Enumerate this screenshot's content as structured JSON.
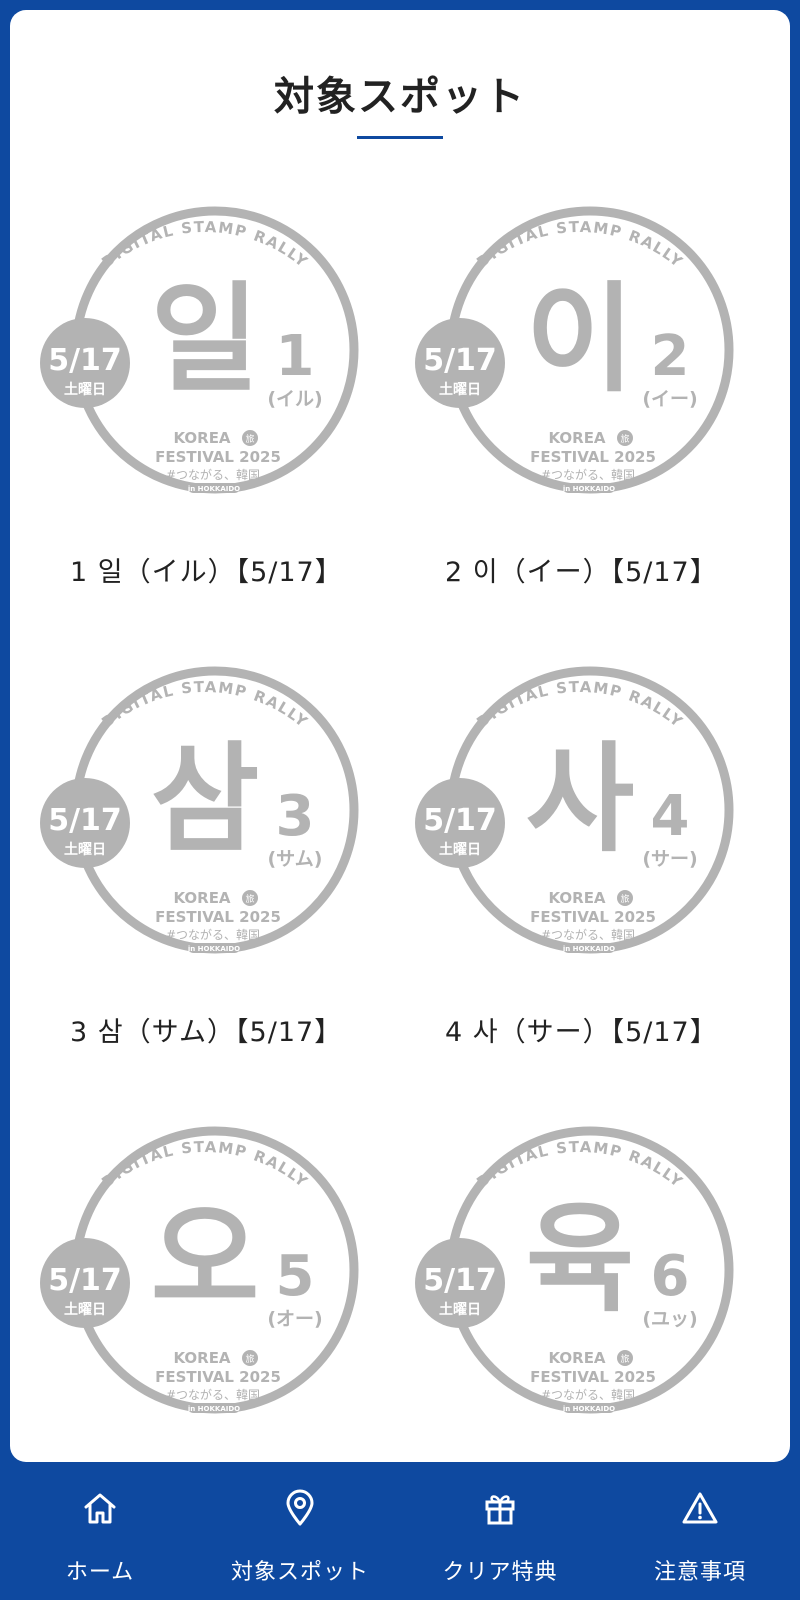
{
  "page": {
    "title": "対象スポット"
  },
  "stamp_common": {
    "arc_text": "DIGITAL STAMP RALLY",
    "date": "5/17",
    "weekday": "土曜日",
    "logo_line1": "KOREA",
    "logo_badge": "旅",
    "logo_line2": "FESTIVAL 2025",
    "hashtag": "#つながる、韓国",
    "location": "in HOKKAIDO"
  },
  "spots": [
    {
      "hangul": "일",
      "number": "1",
      "reading": "(イル)",
      "label": "1 일（イル）【5/17】"
    },
    {
      "hangul": "이",
      "number": "2",
      "reading": "(イー)",
      "label": "2 이（イー）【5/17】"
    },
    {
      "hangul": "삼",
      "number": "3",
      "reading": "(サム)",
      "label": "3 삼（サム）【5/17】"
    },
    {
      "hangul": "사",
      "number": "4",
      "reading": "(サー)",
      "label": "4 사（サー）【5/17】"
    },
    {
      "hangul": "오",
      "number": "5",
      "reading": "(オー)",
      "label": ""
    },
    {
      "hangul": "육",
      "number": "6",
      "reading": "(ユッ)",
      "label": ""
    }
  ],
  "colors": {
    "brand_blue": "#0e49a0",
    "stamp_gray": "#b3b3b3",
    "text_dark": "#222222"
  },
  "nav": {
    "items": [
      {
        "label": "ホーム",
        "icon": "home-icon"
      },
      {
        "label": "対象スポット",
        "icon": "map-pin-icon"
      },
      {
        "label": "クリア特典",
        "icon": "gift-icon"
      },
      {
        "label": "注意事項",
        "icon": "warning-icon"
      }
    ]
  }
}
